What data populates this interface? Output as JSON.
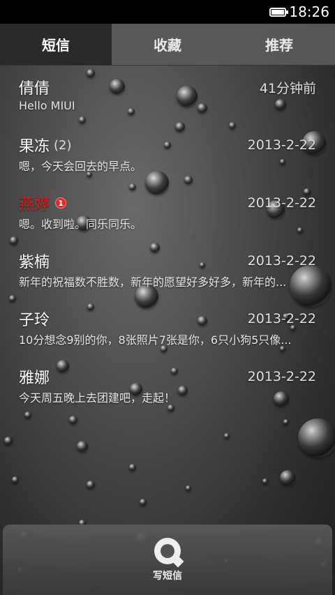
{
  "status_bar": {
    "time": "18:26",
    "battery_icon": "battery-full-icon"
  },
  "tabs": [
    {
      "label": "短信",
      "active": true
    },
    {
      "label": "收藏",
      "active": false
    },
    {
      "label": "推荐",
      "active": false
    }
  ],
  "messages": [
    {
      "name": "倩倩",
      "count": "",
      "unread": "",
      "date": "41分钟前",
      "preview": "Hello MIUI"
    },
    {
      "name": "果冻",
      "count": "(2)",
      "unread": "",
      "date": "2013-2-22",
      "preview": "嗯，今天会回去的早点。"
    },
    {
      "name": "燕婷",
      "count": "",
      "unread": "1",
      "date": "2013-2-22",
      "preview": "嗯。收到啦。同乐同乐。"
    },
    {
      "name": "紫楠",
      "count": "",
      "unread": "",
      "date": "2013-2-22",
      "preview": "新年的祝福数不胜数，新年的愿望好多好多，新年的..."
    },
    {
      "name": "子玲",
      "count": "",
      "unread": "",
      "date": "2013-2-22",
      "preview": "10分想念9别的你，8张照片7张是你，6只小狗5只像..."
    },
    {
      "name": "雅娜",
      "count": "",
      "unread": "",
      "date": "2013-2-22",
      "preview": "今天周五晚上去团建吧，走起！"
    }
  ],
  "compose": {
    "label": "写短信",
    "icon": "compose-chat-icon"
  },
  "colors": {
    "unread_name": "#d82020",
    "badge": "#e02a2a",
    "status_bar": "#000000"
  }
}
